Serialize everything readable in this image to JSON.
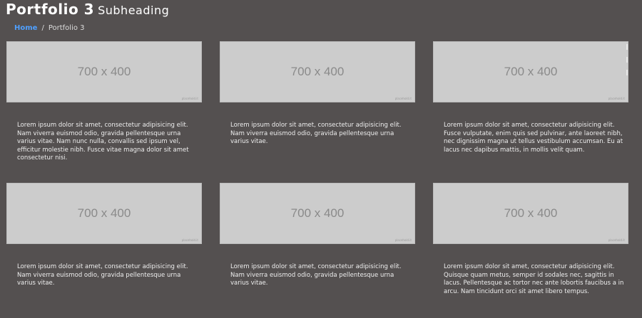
{
  "header": {
    "title": "Portfolio 3",
    "subtitle": "Subheading"
  },
  "breadcrumb": {
    "home": "Home",
    "separator": "/",
    "current": "Portfolio 3"
  },
  "projects": [
    {
      "image_label": "700 x 400",
      "image_credit": "placehold.it",
      "description": "Lorem ipsum dolor sit amet, consectetur adipisicing elit. Nam viverra euismod odio, gravida pellentesque urna varius vitae. Nam nunc nulla, convallis sed ipsum vel, efficitur molestie nibh. Fusce vitae magna dolor sit amet consectetur nisi."
    },
    {
      "image_label": "700 x 400",
      "image_credit": "placehold.it",
      "description": "Lorem ipsum dolor sit amet, consectetur adipisicing elit. Nam viverra euismod odio, gravida pellentesque urna varius vitae."
    },
    {
      "image_label": "700 x 400",
      "image_credit": "placehold.it",
      "description": "Lorem ipsum dolor sit amet, consectetur adipisicing elit. Fusce vulputate, enim quis sed pulvinar, ante laoreet nibh, nec dignissim magna ut tellus vestibulum accumsan. Eu at lacus nec dapibus mattis, in mollis velit quam."
    },
    {
      "image_label": "700 x 400",
      "image_credit": "placehold.it",
      "description": "Lorem ipsum dolor sit amet, consectetur adipisicing elit. Nam viverra euismod odio, gravida pellentesque urna varius vitae."
    },
    {
      "image_label": "700 x 400",
      "image_credit": "placehold.it",
      "description": "Lorem ipsum dolor sit amet, consectetur adipisicing elit. Nam viverra euismod odio, gravida pellentesque urna varius vitae."
    },
    {
      "image_label": "700 x 400",
      "image_credit": "placehold.it",
      "description": "Lorem ipsum dolor sit amet, consectetur adipisicing elit. Quisque quam metus, semper id sodales nec, sagittis in lacus. Pellentesque ac tortor nec ante lobortis faucibus a in arcu. Nam tincidunt orci sit amet libero tempus."
    }
  ]
}
